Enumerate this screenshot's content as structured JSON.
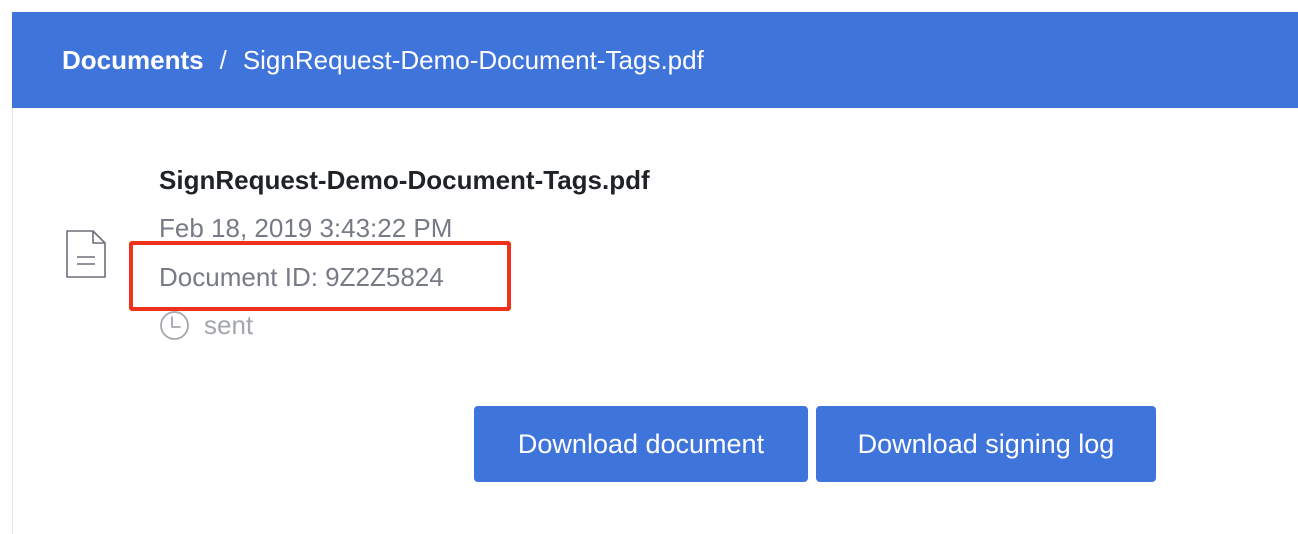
{
  "breadcrumb": {
    "root": "Documents",
    "separator": "/",
    "current": "SignRequest-Demo-Document-Tags.pdf"
  },
  "document": {
    "title": "SignRequest-Demo-Document-Tags.pdf",
    "date": "Feb 18, 2019 3:43:22 PM",
    "id_line": "Document ID: 9Z2Z5824",
    "status": "sent",
    "icon": "document-icon",
    "status_icon": "clock-icon"
  },
  "actions": {
    "download_document": "Download document",
    "download_signing_log": "Download signing log"
  },
  "colors": {
    "brand": "#3f74db",
    "highlight": "#f0311b",
    "muted_text": "#777b85",
    "status_text": "#a4a7ae"
  }
}
